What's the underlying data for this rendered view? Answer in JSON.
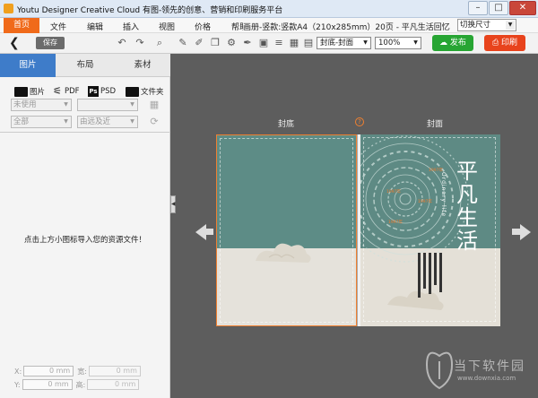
{
  "window": {
    "title": "Youtu Designer Creative Cloud 有图-领先的创意、营销和印刷服务平台",
    "controls": [
      "minimize",
      "maximize",
      "close"
    ]
  },
  "menu": {
    "items": [
      "首页",
      "文件",
      "编辑",
      "插入",
      "视图",
      "价格",
      "帮助"
    ],
    "active_index": 0,
    "document_title": "画册-竖款:竖款A4（210x285mm）20页 - 平凡生活回忆",
    "size_switch": "切换尺寸"
  },
  "toolbar": {
    "save_label": "保存",
    "page_select": "封底-封面",
    "zoom": "100%",
    "publish_label": "发布",
    "print_label": "印刷"
  },
  "sidebar": {
    "tabs": [
      "图片",
      "布局",
      "素材"
    ],
    "active_tab": 0,
    "sources": [
      "图片",
      "PDF",
      "PSD",
      "文件夹"
    ],
    "filter_usage": "未使用",
    "filter_scope": "全部",
    "filter_sort": "由远及近",
    "empty_message": "点击上方小图标导入您的资源文件！",
    "coords": {
      "x_label": "X:",
      "x_value": "0 mm",
      "y_label": "Y:",
      "y_value": "0 mm",
      "w_label": "宽:",
      "w_value": "0 mm",
      "h_label": "高:",
      "h_value": "0 mm"
    }
  },
  "canvas": {
    "left_page_label": "封底",
    "right_page_label": "封面",
    "help_mark": "?",
    "cover_title": "平凡生活",
    "cover_subtitle": "Ordinary life",
    "year_labels": [
      "1997年",
      "1997年",
      "1997年",
      "1997年"
    ]
  },
  "watermark": {
    "text": "当下软件园",
    "url": "www.downxia.com"
  },
  "colors": {
    "accent_orange": "#f06a1a",
    "tab_blue": "#3e7cc9",
    "publish_green": "#27a533",
    "print_red": "#e8431c",
    "cover_teal": "#5e8a84"
  }
}
